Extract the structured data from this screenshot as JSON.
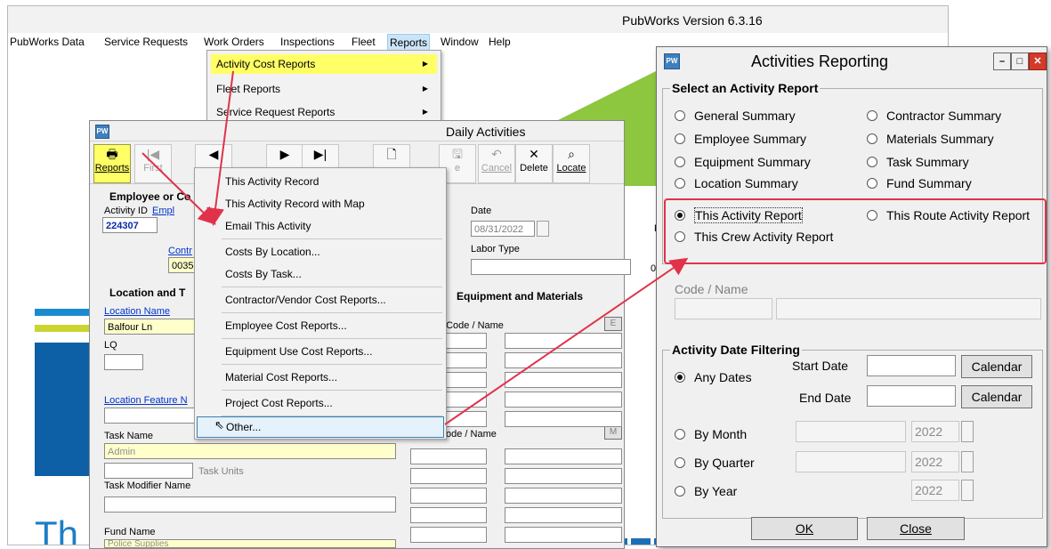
{
  "app": {
    "title": "PubWorks  Version 6.3.16",
    "menu": [
      "PubWorks Data",
      "Service Requests",
      "Work Orders",
      "Inspections",
      "Fleet",
      "Reports",
      "Window",
      "Help"
    ]
  },
  "reports_menu": [
    {
      "label": "Activity Cost Reports",
      "arrow": "▶"
    },
    {
      "label": "Fleet Reports",
      "arrow": "▶"
    },
    {
      "label": "Service Request Reports",
      "arrow": "▶"
    }
  ],
  "daily": {
    "title": "Daily Activities",
    "toolbar": {
      "reports": "Reports",
      "first": "First",
      "cancel": "Cancel",
      "delete": "Delete",
      "locate": "Locate",
      "save_partial": "e"
    },
    "employee_group": "Employee or Co",
    "activity_id_label": "Activity ID",
    "activity_id": "224307",
    "employee_link": "Empl",
    "contractor_link": "Contr",
    "contractor_value": "0035",
    "date_label": "Date",
    "date_value": "08/31/2022",
    "labor_type_label": "Labor Type",
    "zero_label": "0",
    "partial_f": "F",
    "location_group": "Location and T",
    "location_name_link": "Location Name",
    "location_name": "Balfour Ln",
    "lq_label": "LQ",
    "location_feature_link": "Location Feature N",
    "task_name_label": "Task Name",
    "task_name": "Admin",
    "task_units_label": "Task Units",
    "task_modifier_label": "Task Modifier Name",
    "fund_name_label": "Fund Name",
    "fund_name": "Police Supplies",
    "equip_group": "Equipment and Materials",
    "equip_code_label": "t Code / Name",
    "equip_e": "E",
    "mat_code_label": "ode / Name",
    "mat_m": "M"
  },
  "context_menu": [
    "This Activity Record",
    "This Activity Record with Map",
    "Email This Activity",
    "Costs By Location...",
    "Costs By Task...",
    "Contractor/Vendor Cost Reports...",
    "Employee Cost Reports...",
    "Equipment Use Cost Reports...",
    "Material Cost Reports...",
    "Project Cost Reports...",
    "Other..."
  ],
  "dialog": {
    "title": "Activities Reporting",
    "select_group": "Select an Activity Report",
    "radios_left": [
      "General Summary",
      "Employee Summary",
      "Equipment Summary",
      "Location Summary"
    ],
    "radios_right": [
      "Contractor Summary",
      "Materials Summary",
      "Task Summary",
      "Fund Summary"
    ],
    "this_activity": "This Activity Report",
    "this_route": "This Route Activity Report",
    "this_crew": "This Crew Activity Report",
    "code_name_label": "Code / Name",
    "date_group": "Activity Date Filtering",
    "any_dates": "Any Dates",
    "start_date": "Start Date",
    "end_date": "End Date",
    "calendar": "Calendar",
    "by_month": "By Month",
    "by_quarter": "By Quarter",
    "by_year": "By Year",
    "year_value": "2022",
    "ok": "OK",
    "close": "Close"
  },
  "colors": {
    "highlight_yellow": "#ffff66",
    "arrow_red": "#e0334a",
    "link_blue": "#0033cc"
  }
}
